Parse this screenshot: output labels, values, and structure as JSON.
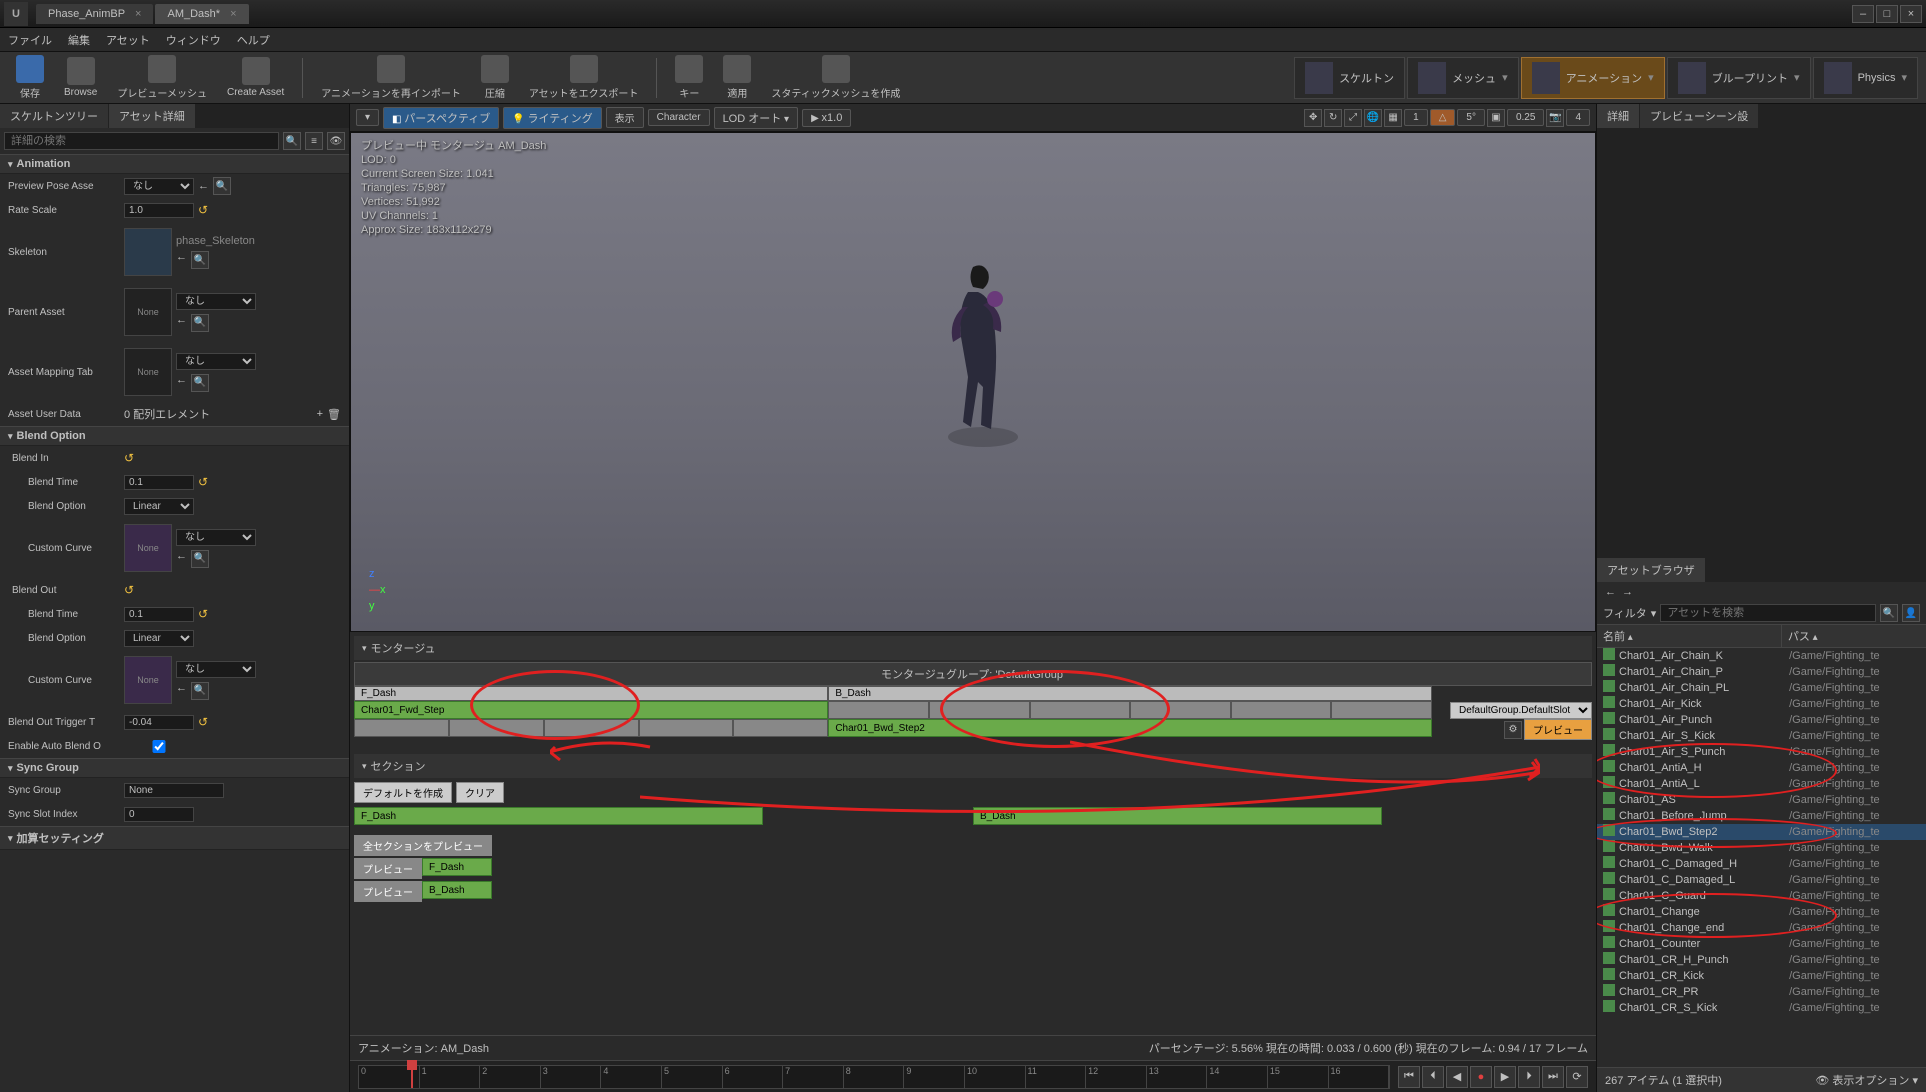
{
  "tabs": {
    "t1": "Phase_AnimBP",
    "t2": "AM_Dash*"
  },
  "menu": {
    "file": "ファイル",
    "edit": "編集",
    "asset": "アセット",
    "window": "ウィンドウ",
    "help": "ヘルプ"
  },
  "toolbar": {
    "save": "保存",
    "browse": "Browse",
    "preview_mesh": "プレビューメッシュ",
    "create_asset": "Create Asset",
    "reimport": "アニメーションを再インポート",
    "compress": "圧縮",
    "export": "アセットをエクスポート",
    "key": "キー",
    "apply": "適用",
    "make_static": "スタティックメッシュを作成"
  },
  "modes": {
    "skeleton": "スケルトン",
    "mesh": "メッシュ",
    "anim": "アニメーション",
    "blueprint": "ブループリント",
    "physics": "Physics"
  },
  "left_tabs": {
    "tree": "スケルトンツリー",
    "detail": "アセット詳細"
  },
  "search_ph": "詳細の検索",
  "cat": {
    "animation": "Animation",
    "blend": "Blend Option",
    "sync": "Sync Group",
    "add": "加算セッティング"
  },
  "props": {
    "preview_pose": "Preview Pose Asse",
    "none_label": "なし",
    "rate_scale": "Rate Scale",
    "rate_scale_v": "1.0",
    "skeleton": "Skeleton",
    "skeleton_name": "phase_Skeleton",
    "parent": "Parent Asset",
    "none": "None",
    "mapping": "Asset Mapping Tab",
    "user_data": "Asset User Data",
    "user_data_v": "0 配列エレメント",
    "blend_in": "Blend In",
    "blend_time": "Blend Time",
    "bt_in": "0.1",
    "blend_option": "Blend Option",
    "linear": "Linear",
    "custom_curve": "Custom Curve",
    "blend_out": "Blend Out",
    "bt_out": "0.1",
    "trigger": "Blend Out Trigger T",
    "trigger_v": "-0.04",
    "auto_blend": "Enable Auto Blend O",
    "sync_group": "Sync Group",
    "sync_none": "None",
    "sync_slot": "Sync Slot Index",
    "sync_slot_v": "0"
  },
  "vp_toolbar": {
    "persp": "パースペクティブ",
    "lighting": "ライティング",
    "show": "表示",
    "char": "Character",
    "lod": "LOD オート",
    "speed": "x1.0",
    "snap": "5°",
    "grid": "1",
    "scale": "0.25",
    "fov": "4"
  },
  "vp_stats": {
    "l1": "プレビュー中 モンタージュ AM_Dash",
    "l2": "LOD: 0",
    "l3": "Current Screen Size: 1.041",
    "l4": "Triangles: 75,987",
    "l5": "Vertices: 51,992",
    "l6": "UV Channels: 1",
    "l7": "Approx Size: 183x112x279"
  },
  "montage": {
    "title": "モンタージュ",
    "group": "モンタージュグループ: 'DefaultGroup'",
    "f_dash": "F_Dash",
    "b_dash": "B_Dash",
    "clip1": "Char01_Fwd_Step",
    "clip2": "Char01_Bwd_Step2",
    "slot": "DefaultGroup.DefaultSlot",
    "preview": "プレビュー",
    "sections": "セクション",
    "default": "デフォルトを作成",
    "clear": "クリア",
    "all_preview": "全セクションをプレビュー",
    "anim_name": "アニメーション: AM_Dash",
    "footer": "パーセンテージ: 5.56% 現在の時間: 0.033 / 0.600 (秒) 現在のフレーム: 0.94 / 17 フレーム"
  },
  "ticks": [
    "0",
    "1",
    "2",
    "3",
    "4",
    "5",
    "6",
    "7",
    "8",
    "9",
    "10",
    "11",
    "12",
    "13",
    "14",
    "15",
    "16"
  ],
  "right_tabs": {
    "details": "詳細",
    "scene": "プレビューシーン設"
  },
  "ab": {
    "title": "アセットブラウザ",
    "filter": "フィルタ",
    "search_ph": "アセットを検索",
    "col_name": "名前",
    "col_path": "パス",
    "status": "267 アイテム (1 選択中)",
    "view_opt": "表示オプション"
  },
  "assets": [
    {
      "n": "Char01_Air_Chain_K",
      "p": "/Game/Fighting_te"
    },
    {
      "n": "Char01_Air_Chain_P",
      "p": "/Game/Fighting_te"
    },
    {
      "n": "Char01_Air_Chain_PL",
      "p": "/Game/Fighting_te"
    },
    {
      "n": "Char01_Air_Kick",
      "p": "/Game/Fighting_te"
    },
    {
      "n": "Char01_Air_Punch",
      "p": "/Game/Fighting_te"
    },
    {
      "n": "Char01_Air_S_Kick",
      "p": "/Game/Fighting_te"
    },
    {
      "n": "Char01_Air_S_Punch",
      "p": "/Game/Fighting_te"
    },
    {
      "n": "Char01_AntiA_H",
      "p": "/Game/Fighting_te"
    },
    {
      "n": "Char01_AntiA_L",
      "p": "/Game/Fighting_te"
    },
    {
      "n": "Char01_AS",
      "p": "/Game/Fighting_te"
    },
    {
      "n": "Char01_Before_Jump",
      "p": "/Game/Fighting_te"
    },
    {
      "n": "Char01_Bwd_Step2",
      "p": "/Game/Fighting_te"
    },
    {
      "n": "Char01_Bwd_Walk",
      "p": "/Game/Fighting_te"
    },
    {
      "n": "Char01_C_Damaged_H",
      "p": "/Game/Fighting_te"
    },
    {
      "n": "Char01_C_Damaged_L",
      "p": "/Game/Fighting_te"
    },
    {
      "n": "Char01_C_Guard",
      "p": "/Game/Fighting_te"
    },
    {
      "n": "Char01_Change",
      "p": "/Game/Fighting_te"
    },
    {
      "n": "Char01_Change_end",
      "p": "/Game/Fighting_te"
    },
    {
      "n": "Char01_Counter",
      "p": "/Game/Fighting_te"
    },
    {
      "n": "Char01_CR_H_Punch",
      "p": "/Game/Fighting_te"
    },
    {
      "n": "Char01_CR_Kick",
      "p": "/Game/Fighting_te"
    },
    {
      "n": "Char01_CR_PR",
      "p": "/Game/Fighting_te"
    },
    {
      "n": "Char01_CR_S_Kick",
      "p": "/Game/Fighting_te"
    }
  ]
}
